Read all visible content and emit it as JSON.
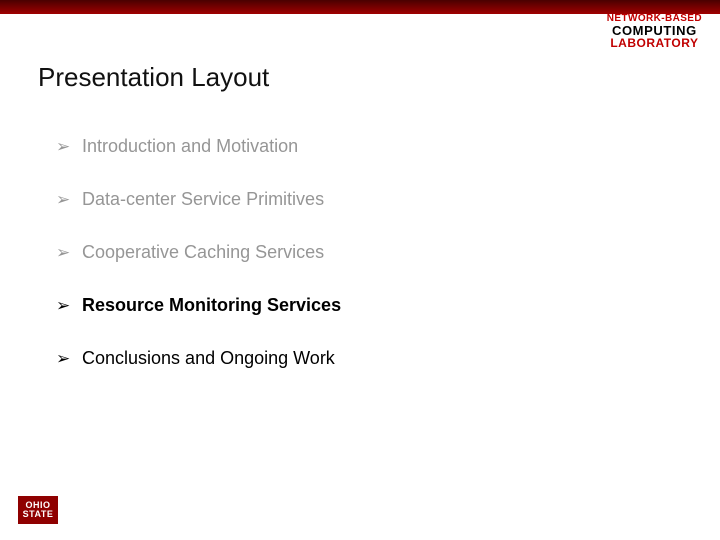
{
  "header_logo": {
    "line1": "NETWORK-BASED",
    "line2": "COMPUTING",
    "line3": "LABORATORY"
  },
  "title": "Presentation Layout",
  "bullets": [
    {
      "marker": "➢",
      "text": "Introduction and Motivation",
      "style": "dim"
    },
    {
      "marker": "➢",
      "text": "Data-center Service Primitives",
      "style": "dim"
    },
    {
      "marker": "➢",
      "text": "Cooperative Caching Services",
      "style": "dim"
    },
    {
      "marker": "➢",
      "text": "Resource Monitoring Services",
      "style": "bold"
    },
    {
      "marker": "➢",
      "text": "Conclusions and Ongoing Work",
      "style": "norm"
    }
  ],
  "footer_logo": {
    "line1": "OHIO",
    "line2": "STATE"
  }
}
